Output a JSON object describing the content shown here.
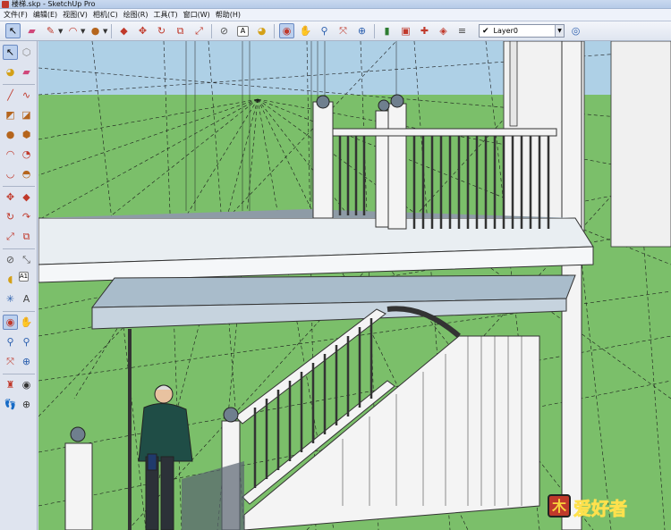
{
  "window": {
    "title": "楼梯.skp - SketchUp Pro"
  },
  "menubar": {
    "items": [
      {
        "label": "文件(F)"
      },
      {
        "label": "编辑(E)"
      },
      {
        "label": "视图(V)"
      },
      {
        "label": "相机(C)"
      },
      {
        "label": "绘图(R)"
      },
      {
        "label": "工具(T)"
      },
      {
        "label": "窗口(W)"
      },
      {
        "label": "帮助(H)"
      }
    ]
  },
  "toolbar": {
    "layer": {
      "check": "✔",
      "name": "Layer0"
    },
    "icons": [
      "select-icon",
      "eraser-icon",
      "pencil-icon",
      "arc-icon",
      "circle-icon",
      "push-pull-icon",
      "move-icon",
      "rotate-icon",
      "offset-icon",
      "scale-icon",
      "tape-measure-icon",
      "text-icon",
      "paint-bucket-icon",
      "orbit-icon",
      "pan-icon",
      "zoom-icon",
      "zoom-extents-icon",
      "previous-view-icon",
      "warehouse-icon",
      "share-model-icon",
      "components-icon",
      "extensions-icon",
      "layer-manager-icon"
    ]
  },
  "left_toolbar": {
    "icons": [
      "select-icon",
      "make-component-icon",
      "paint-bucket-icon",
      "eraser-icon",
      "line-icon",
      "freehand-icon",
      "rectangle-icon",
      "rotated-rectangle-icon",
      "circle-icon",
      "polygon-icon",
      "arc-icon",
      "pie-icon",
      "arc-2pt-icon",
      "arc-3pt-icon",
      "move-icon",
      "push-pull-icon",
      "rotate-icon",
      "follow-me-icon",
      "scale-icon",
      "offset-icon",
      "tape-measure-icon",
      "dimension-icon",
      "protractor-icon",
      "text-icon",
      "axes-icon",
      "3d-text-icon",
      "orbit-icon",
      "pan-icon",
      "zoom-icon",
      "zoom-window-icon",
      "zoom-extents-icon",
      "previous-icon",
      "position-camera-icon",
      "look-around-icon",
      "walk-icon",
      "section-plane-icon"
    ]
  },
  "watermark": {
    "text": "爱好者",
    "icon_glyph": "木"
  },
  "colors": {
    "sky": "#aed0e6",
    "grass": "#7bbf6a",
    "structure": "#f2f2f2",
    "beam": "#a9bccb",
    "shadow": "#6f7f8e",
    "watermark_text": "#e8302b"
  }
}
